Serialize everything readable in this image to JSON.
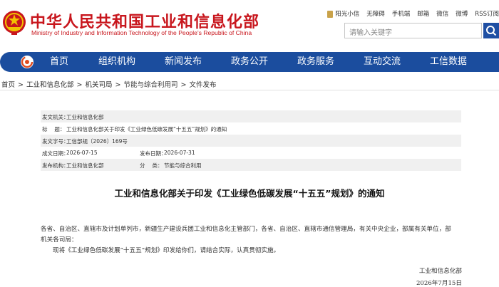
{
  "header": {
    "title": "中华人民共和国工业和信息化部",
    "subtitle": "Ministry of Industry and Information Technology of the People's Republic of China",
    "brand_color": "#c8161d",
    "top_links": [
      "阳光小信",
      "无障碍",
      "手机端",
      "邮箱",
      "微信",
      "微博",
      "RSS订阅"
    ],
    "search_placeholder": "请输入关键字"
  },
  "nav": {
    "color": "#1b4d9e",
    "items": [
      "首页",
      "组织机构",
      "新闻发布",
      "政务公开",
      "政务服务",
      "互动交流",
      "工信数据"
    ]
  },
  "breadcrumb": [
    "首页",
    "工业和信息化部",
    "机关司局",
    "节能与综合利用司",
    "文件发布"
  ],
  "meta": {
    "issuer_label": "发文机关：",
    "issuer": "工业和信息化部",
    "subject_label": "标　 题：",
    "subject": "工业和信息化部关于印发《工业绿色低碳发展“十五五”规划》的通知",
    "docno_label": "发文字号：",
    "docno": "工信部规〔2026〕169号",
    "created_label": "成文日期：",
    "created": "2026-07-15",
    "published_label": "发布日期：",
    "published": "2026-07-31",
    "pubbody_label": "发布机构：",
    "pubbody": "工业和信息化部",
    "category_label": "分　 类：",
    "category": "节能与综合利用"
  },
  "document": {
    "title": "工业和信息化部关于印发《工业绿色低碳发展“十五五”规划》的通知",
    "para1_line1": "各省、自治区、直辖市及计划单列市，新疆生产建设兵团工业和信息化主管部门，各省、自治区、直辖市通信管理局，有关中央企业，部属有关单位，部",
    "para1_line2": "机关各司局：",
    "para2": "现将《工业绿色低碳发展“十五五”规划》印发给你们，请结合实际，认真贯彻实施。",
    "signer": "工业和信息化部",
    "date": "2026年7月15日"
  }
}
